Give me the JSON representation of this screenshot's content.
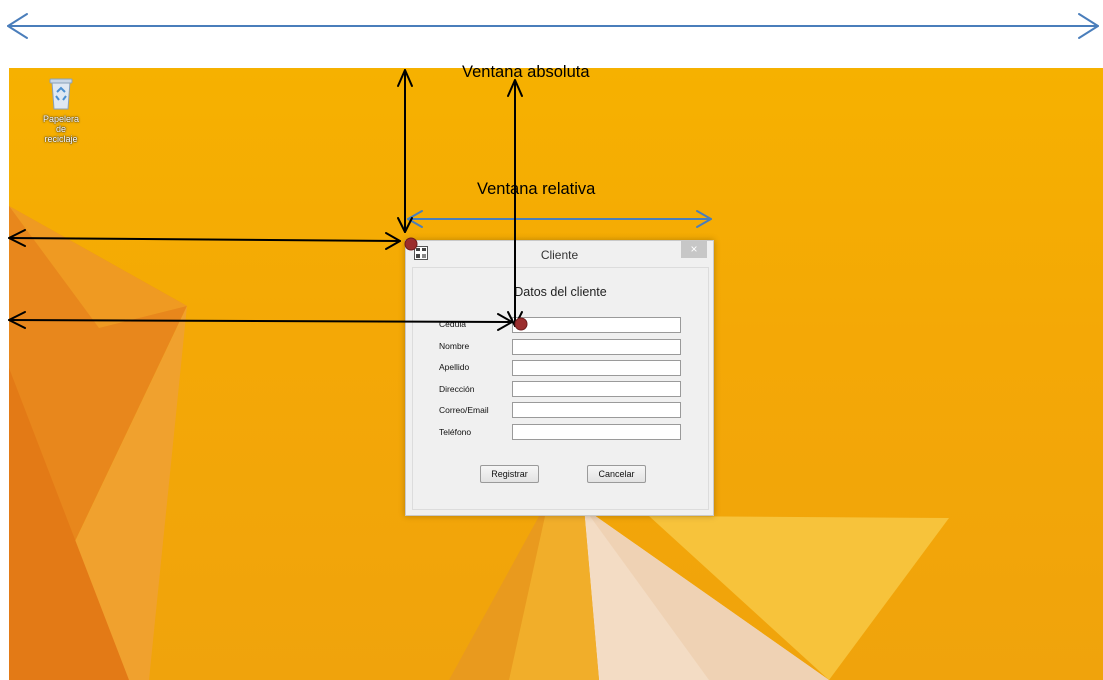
{
  "desktop": {
    "recycle_bin_label": "Papelera de reciclaje",
    "wallpaper_colors": {
      "base": "#f4a806",
      "light": "#f8c232",
      "dark": "#e07a16",
      "cream": "#f3dcc4"
    }
  },
  "annotations": {
    "absolute_window_label": "Ventana absoluta",
    "relative_window_label": "Ventana relativa",
    "arrow_color_black": "#000000",
    "arrow_color_blue": "#4a7ebb",
    "marker_color": "#9b2d2d"
  },
  "window": {
    "title": "Cliente",
    "close_symbol": "×",
    "heading": "Datos del cliente",
    "fields": [
      {
        "label": "Cédula",
        "value": ""
      },
      {
        "label": "Nombre",
        "value": ""
      },
      {
        "label": "Apellido",
        "value": ""
      },
      {
        "label": "Dirección",
        "value": ""
      },
      {
        "label": "Correo/Email",
        "value": ""
      },
      {
        "label": "Teléfono",
        "value": ""
      }
    ],
    "buttons": {
      "register": "Registrar",
      "cancel": "Cancelar"
    }
  }
}
